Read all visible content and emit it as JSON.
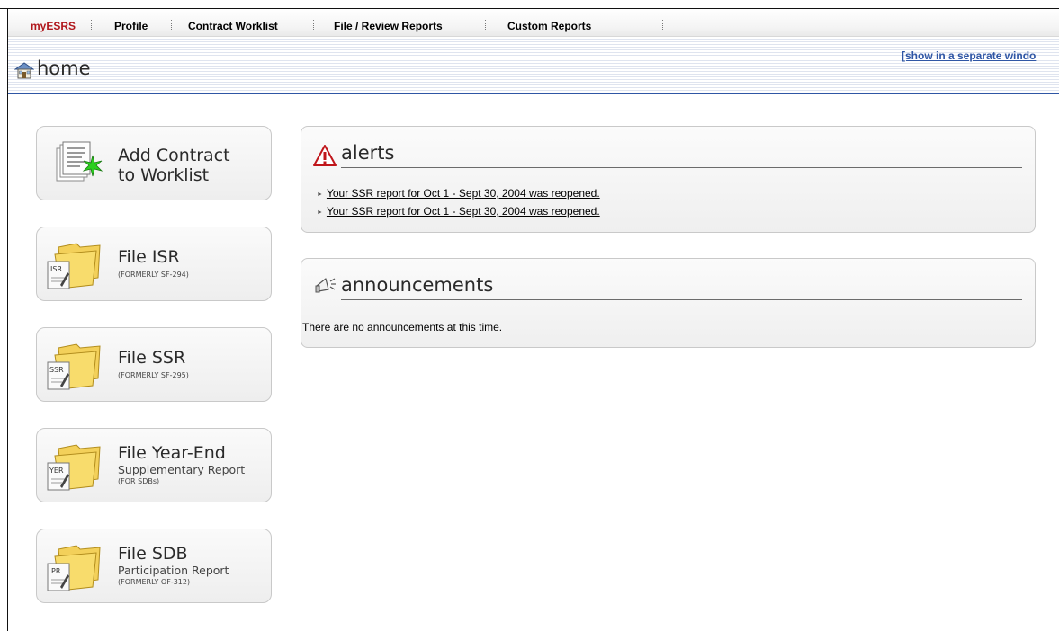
{
  "nav": {
    "items": [
      {
        "label": "myESRS"
      },
      {
        "label": "Profile"
      },
      {
        "label": "Contract Worklist"
      },
      {
        "label": "File / Review Reports"
      },
      {
        "label": "Custom Reports"
      }
    ]
  },
  "header": {
    "title": "home",
    "separate_window_link": "[show in a separate windo"
  },
  "tiles": [
    {
      "title_line1": "Add Contract",
      "title_line2": "to Worklist",
      "icon": "add-contract-icon"
    },
    {
      "title": "File ISR",
      "small": "(FORMERLY SF-294)",
      "icon_label": "ISR",
      "icon": "folder-icon"
    },
    {
      "title": "File SSR",
      "small": "(FORMERLY SF-295)",
      "icon_label": "SSR",
      "icon": "folder-icon"
    },
    {
      "title": "File Year-End",
      "subtitle": "Supplementary Report",
      "small": "(FOR SDBs)",
      "icon_label": "YER",
      "icon": "folder-icon"
    },
    {
      "title": "File SDB",
      "subtitle": "Participation Report",
      "small": "(FORMERLY OF-312)",
      "icon_label": "PR",
      "icon": "folder-icon"
    }
  ],
  "alerts": {
    "title": "alerts",
    "items": [
      "Your SSR report for Oct 1 - Sept 30, 2004 was reopened.",
      "Your SSR report for Oct 1 - Sept 30, 2004 was reopened."
    ]
  },
  "announcements": {
    "title": "announcements",
    "message": "There are no announcements at this time."
  },
  "colors": {
    "brand": "#b0161b",
    "link_blue": "#2f56a5",
    "alert_red": "#c0161b"
  }
}
